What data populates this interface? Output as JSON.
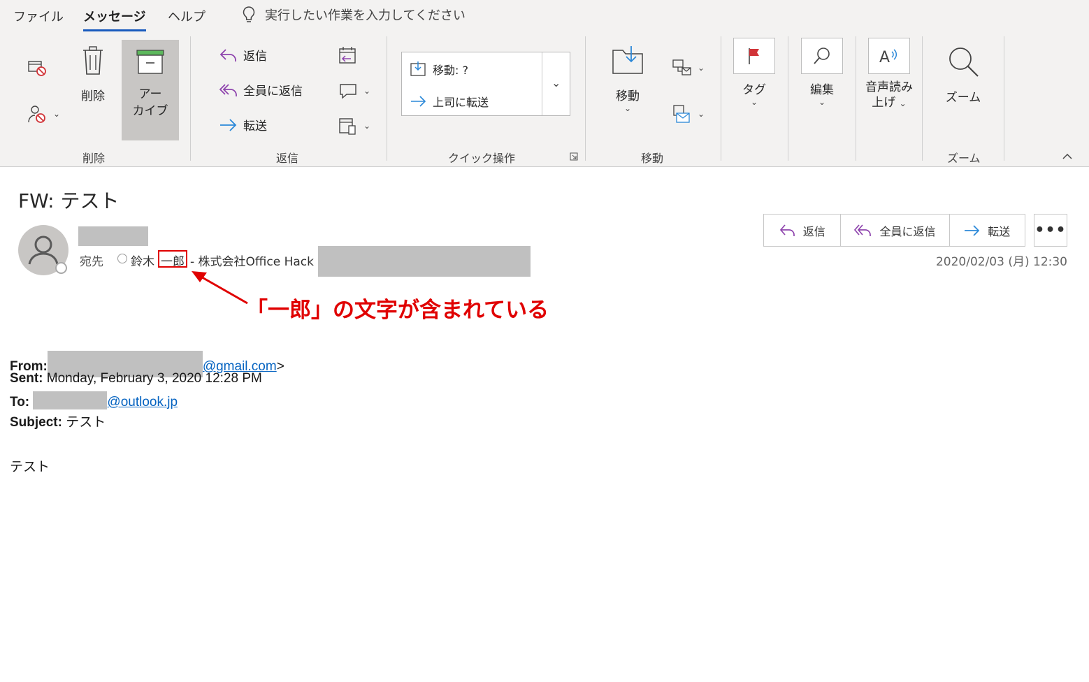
{
  "menu": {
    "tabs": [
      {
        "label": "ファイル"
      },
      {
        "label": "メッセージ"
      },
      {
        "label": "ヘルプ"
      }
    ],
    "tell_me": "実行したい作業を入力してください"
  },
  "ribbon": {
    "delete_group": {
      "label": "削除",
      "delete_button": "削除",
      "archive_line1": "アー",
      "archive_line2": "カイブ"
    },
    "respond_group": {
      "label": "返信",
      "reply": "返信",
      "reply_all": "全員に返信",
      "forward": "転送"
    },
    "quick_steps_group": {
      "label": "クイック操作",
      "move_to": "移動: ?",
      "to_manager": "上司に転送"
    },
    "move_group": {
      "label": "移動",
      "move_button": "移動"
    },
    "tags_group": {
      "button": "タグ"
    },
    "editing_group": {
      "button": "編集"
    },
    "speech_group": {
      "line1": "音声読み",
      "line2": "上げ"
    },
    "zoom_group": {
      "label": "ズーム",
      "button": "ズーム"
    }
  },
  "message": {
    "subject": "FW: テスト",
    "to_label": "宛先",
    "recipient_surname": "鈴木",
    "recipient_given": "一郎",
    "recipient_org": "- 株式会社Office Hack",
    "datetime": "2020/02/03 (月) 12:30",
    "actions": {
      "reply": "返信",
      "reply_all": "全員に返信",
      "forward": "転送"
    }
  },
  "annotation": "「一郎」の文字が含まれている",
  "body": {
    "from_label": "From:",
    "from_email": "@gmail.com",
    "from_suffix": ">",
    "sent_label": "Sent:",
    "sent_value": "Monday, February 3, 2020 12:28 PM",
    "to_label": "To:",
    "to_email": "@outlook.jp",
    "subject_label": "Subject:",
    "subject_value": "テスト",
    "text": "テスト"
  },
  "colors": {
    "ribbon_bg": "#f3f2f1",
    "accent": "#185abd",
    "annotation": "#e00000",
    "link": "#0563c1",
    "redaction": "#c0c0c0"
  }
}
